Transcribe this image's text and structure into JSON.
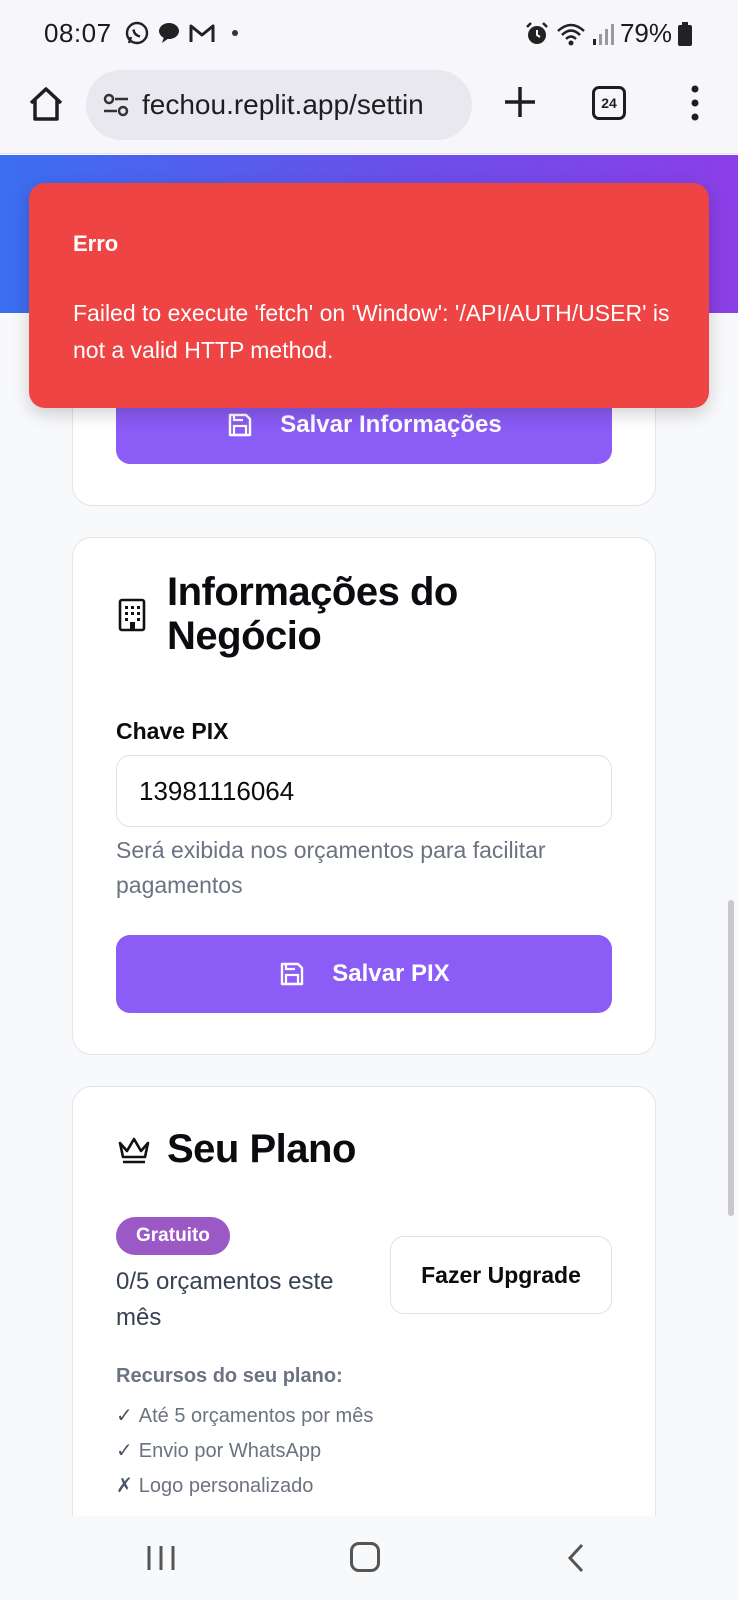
{
  "status_bar": {
    "time": "08:07",
    "battery": "79%",
    "icons": [
      "whatsapp-icon",
      "chat-icon",
      "gmail-icon",
      "alarm-icon",
      "wifi-icon",
      "signal-icon",
      "battery-icon"
    ]
  },
  "browser": {
    "url": "fechou.replit.app/settin",
    "tab_count": "24"
  },
  "toast": {
    "title": "Erro",
    "message": "Failed to execute 'fetch' on 'Window': '/API/AUTH/USER' is not a valid HTTP method.",
    "color": "#ef4444"
  },
  "profile_card": {
    "save_label": "Salvar Informações"
  },
  "business_card": {
    "title": "Informações do Negócio",
    "pix_label": "Chave PIX",
    "pix_value": "13981116064",
    "help_text": "Será exibida nos orçamentos para facilitar pagamentos",
    "save_label": "Salvar PIX"
  },
  "plan_card": {
    "title": "Seu Plano",
    "badge": "Gratuito",
    "usage": "0/5 orçamentos este mês",
    "upgrade_label": "Fazer Upgrade",
    "features_heading": "Recursos do seu plano:",
    "features": [
      {
        "mark": "✓",
        "text": "Até 5 orçamentos por mês"
      },
      {
        "mark": "✓",
        "text": "Envio por WhatsApp"
      },
      {
        "mark": "✗",
        "text": "Logo personalizado"
      }
    ]
  },
  "colors": {
    "accent": "#8b5cf6",
    "badge": "#9b59c6",
    "header_gradient_start": "#3b6ef0",
    "header_gradient_end": "#8b3fe6"
  }
}
